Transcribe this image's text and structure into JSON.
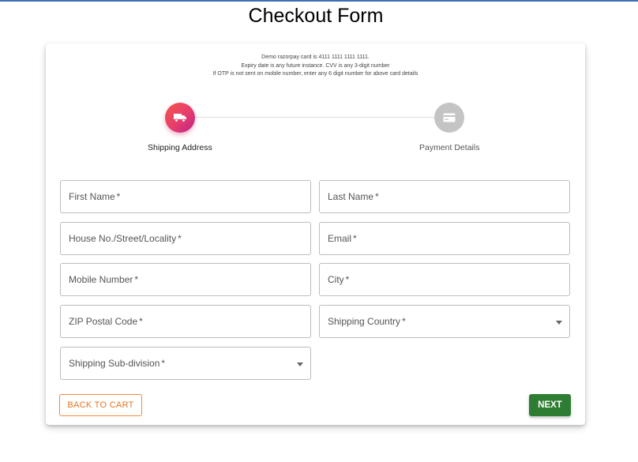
{
  "page": {
    "title": "Checkout Form"
  },
  "notes": {
    "line1": "Demo razorpay card is 4111 1111 1111 1111.",
    "line2": "Expiry date is any future instance. CVV is any 3-digit number",
    "line3": "If OTP is not sent on mobile number, enter any 6 digit number for above card details"
  },
  "stepper": {
    "steps": [
      {
        "label": "Shipping Address",
        "icon": "truck-icon",
        "state": "active"
      },
      {
        "label": "Payment Details",
        "icon": "credit-card-icon",
        "state": "inactive"
      }
    ]
  },
  "form": {
    "required_mark": "*",
    "fields": {
      "first_name": {
        "label": "First Name"
      },
      "last_name": {
        "label": "Last Name"
      },
      "address": {
        "label": "House No./Street/Locality"
      },
      "email": {
        "label": "Email"
      },
      "mobile": {
        "label": "Mobile Number"
      },
      "city": {
        "label": "City"
      },
      "zip": {
        "label": "ZIP Postal Code"
      },
      "country": {
        "label": "Shipping Country"
      },
      "subdivision": {
        "label": "Shipping Sub-division"
      }
    }
  },
  "actions": {
    "back_label": "BACK TO CART",
    "next_label": "NEXT"
  },
  "colors": {
    "accent_gradient_start": "#f3564c",
    "accent_gradient_end": "#b9238a",
    "inactive_step": "#c4c4c4",
    "back_button": "#e8731f",
    "next_button": "#2e7d32"
  }
}
